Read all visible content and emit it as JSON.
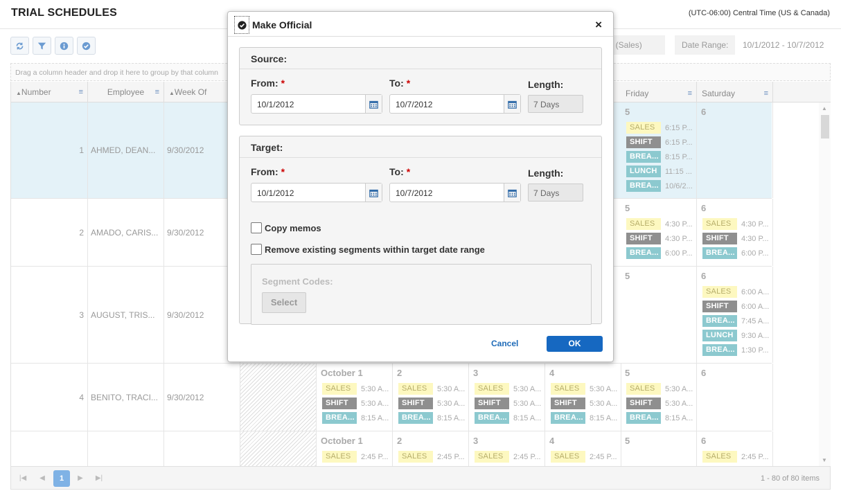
{
  "header": {
    "title": "TRIAL SCHEDULES",
    "timezone": "(UTC-06:00) Central Time (US & Canada)"
  },
  "toolbar": {
    "buttons": [
      "refresh-icon",
      "filter-icon",
      "info-icon",
      "check-circle-icon"
    ],
    "view_label": "les (Sales)",
    "date_range_label": "Date Range:",
    "date_range_value": "10/1/2012 - 10/7/2012"
  },
  "group_hint": "Drag a column header and drop it here to group by that column",
  "columns": {
    "number": "Number",
    "employee": "Employee",
    "week_of": "Week Of",
    "friday": "Friday",
    "saturday": "Saturday"
  },
  "rows": [
    {
      "num": "1",
      "employee": "AHMED, DEAN...",
      "week": "9/30/2012",
      "fri": {
        "day": "5",
        "segs": [
          [
            "SALES",
            "6:15 P..."
          ],
          [
            "SHIFT",
            "6:15 P..."
          ],
          [
            "BREA...",
            "8:15 P..."
          ],
          [
            "LUNCH",
            "11:15 ..."
          ],
          [
            "BREA...",
            "10/6/2..."
          ]
        ]
      },
      "sat": {
        "day": "6",
        "segs": []
      }
    },
    {
      "num": "2",
      "employee": "AMADO, CARIS...",
      "week": "9/30/2012",
      "fri": {
        "day": "5",
        "segs": [
          [
            "SALES",
            "4:30 P..."
          ],
          [
            "SHIFT",
            "4:30 P..."
          ],
          [
            "BREA...",
            "6:00 P..."
          ]
        ]
      },
      "sat": {
        "day": "6",
        "segs": [
          [
            "SALES",
            "4:30 P..."
          ],
          [
            "SHIFT",
            "4:30 P..."
          ],
          [
            "BREA...",
            "6:00 P..."
          ]
        ]
      }
    },
    {
      "num": "3",
      "employee": "AUGUST, TRIS...",
      "week": "9/30/2012",
      "fri": {
        "day": "5",
        "segs": []
      },
      "sat": {
        "day": "6",
        "segs": [
          [
            "SALES",
            "6:00 A..."
          ],
          [
            "SHIFT",
            "6:00 A..."
          ],
          [
            "BREA...",
            "7:45 A..."
          ],
          [
            "LUNCH",
            "9:30 A..."
          ],
          [
            "BREA...",
            "1:30 P..."
          ]
        ]
      }
    },
    {
      "num": "4",
      "employee": "BENITO, TRACI...",
      "week": "9/30/2012",
      "days": [
        {
          "day": "October 1",
          "segs": [
            [
              "SALES",
              "5:30 A..."
            ],
            [
              "SHIFT",
              "5:30 A..."
            ],
            [
              "BREA...",
              "8:15 A..."
            ]
          ]
        },
        {
          "day": "2",
          "segs": [
            [
              "SALES",
              "5:30 A..."
            ],
            [
              "SHIFT",
              "5:30 A..."
            ],
            [
              "BREA...",
              "8:15 A..."
            ]
          ]
        },
        {
          "day": "3",
          "segs": [
            [
              "SALES",
              "5:30 A..."
            ],
            [
              "SHIFT",
              "5:30 A..."
            ],
            [
              "BREA...",
              "8:15 A..."
            ]
          ]
        },
        {
          "day": "4",
          "segs": [
            [
              "SALES",
              "5:30 A..."
            ],
            [
              "SHIFT",
              "5:30 A..."
            ],
            [
              "BREA...",
              "8:15 A..."
            ]
          ]
        },
        {
          "day": "5",
          "segs": [
            [
              "SALES",
              "5:30 A..."
            ],
            [
              "SHIFT",
              "5:30 A..."
            ],
            [
              "BREA...",
              "8:15 A..."
            ]
          ]
        },
        {
          "day": "6",
          "segs": []
        }
      ]
    },
    {
      "num": "",
      "employee": "",
      "week": "",
      "days": [
        {
          "day": "October 1",
          "segs": [
            [
              "SALES",
              "2:45 P..."
            ]
          ]
        },
        {
          "day": "2",
          "segs": [
            [
              "SALES",
              "2:45 P..."
            ]
          ]
        },
        {
          "day": "3",
          "segs": [
            [
              "SALES",
              "2:45 P..."
            ]
          ]
        },
        {
          "day": "4",
          "segs": [
            [
              "SALES",
              "2:45 P..."
            ]
          ]
        },
        {
          "day": "5",
          "segs": []
        },
        {
          "day": "6",
          "segs": [
            [
              "SALES",
              "2:45 P..."
            ]
          ]
        }
      ]
    }
  ],
  "pager": {
    "page": "1",
    "info": "1 - 80 of 80 items"
  },
  "dialog": {
    "title": "Make Official",
    "close": "×",
    "source": {
      "heading": "Source:",
      "from_label": "From:",
      "to_label": "To:",
      "length_label": "Length:",
      "from": "10/1/2012",
      "to": "10/7/2012",
      "length": "7 Days"
    },
    "target": {
      "heading": "Target:",
      "from_label": "From:",
      "to_label": "To:",
      "length_label": "Length:",
      "from": "10/1/2012",
      "to": "10/7/2012",
      "length": "7 Days"
    },
    "required_mark": "*",
    "copy_memos": "Copy memos",
    "remove_existing": "Remove existing segments within target date range",
    "segment_codes_label": "Segment Codes:",
    "select_button": "Select",
    "cancel": "Cancel",
    "ok": "OK"
  }
}
